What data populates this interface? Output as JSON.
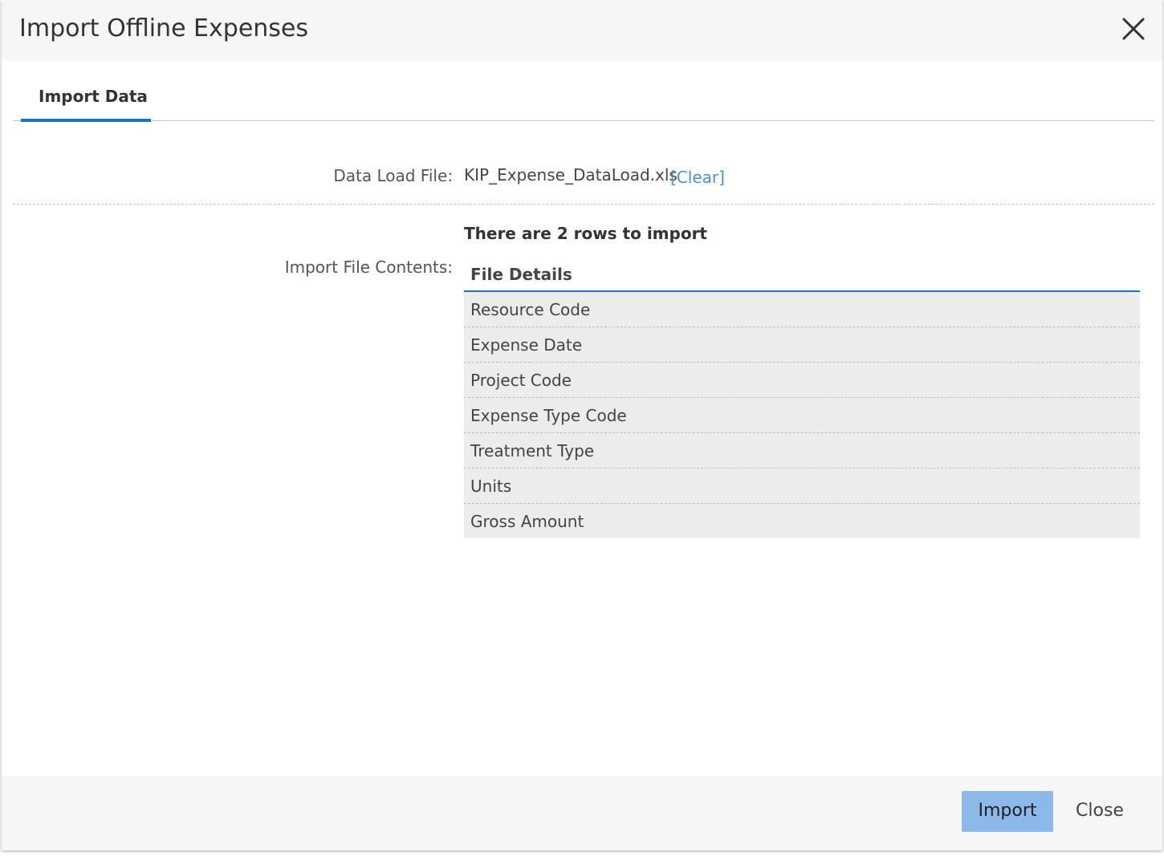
{
  "dialog": {
    "title": "Import Offline Expenses",
    "close_icon": "close-icon"
  },
  "tabs": [
    {
      "label": "Import Data",
      "active": true
    }
  ],
  "form": {
    "data_load_file_label": "Data Load File:",
    "data_load_file_value": "KIP_Expense_DataLoad.xls",
    "clear_link": "[Clear]",
    "rows_message": "There are 2 rows to import",
    "import_file_contents_label": "Import File Contents:"
  },
  "file_details": {
    "header": "File Details",
    "rows": [
      "Resource Code",
      "Expense Date",
      "Project Code",
      "Expense Type Code",
      "Treatment Type",
      "Units",
      "Gross Amount"
    ]
  },
  "footer": {
    "import_label": "Import",
    "close_label": "Close"
  },
  "colors": {
    "accent": "#1a73c8",
    "import_button": "#8cb8ea",
    "link": "#4a90c9",
    "row_background": "#ececec"
  }
}
